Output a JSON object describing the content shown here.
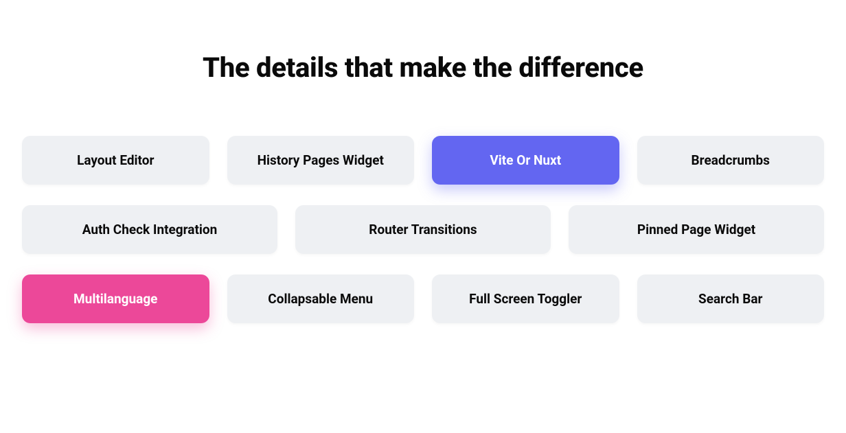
{
  "heading": "The details that make the difference",
  "rows": [
    [
      {
        "label": "Layout Editor",
        "variant": "default"
      },
      {
        "label": "History Pages Widget",
        "variant": "default"
      },
      {
        "label": "Vite Or Nuxt",
        "variant": "indigo"
      },
      {
        "label": "Breadcrumbs",
        "variant": "default"
      }
    ],
    [
      {
        "label": "Auth Check Integration",
        "variant": "default"
      },
      {
        "label": "Router Transitions",
        "variant": "default"
      },
      {
        "label": "Pinned Page Widget",
        "variant": "default"
      }
    ],
    [
      {
        "label": "Multilanguage",
        "variant": "pink"
      },
      {
        "label": "Collapsable Menu",
        "variant": "default"
      },
      {
        "label": "Full Screen Toggler",
        "variant": "default"
      },
      {
        "label": "Search Bar",
        "variant": "default"
      }
    ]
  ],
  "colors": {
    "indigo": "#6366f1",
    "pink": "#ec4899",
    "neutral": "#eef0f3"
  }
}
